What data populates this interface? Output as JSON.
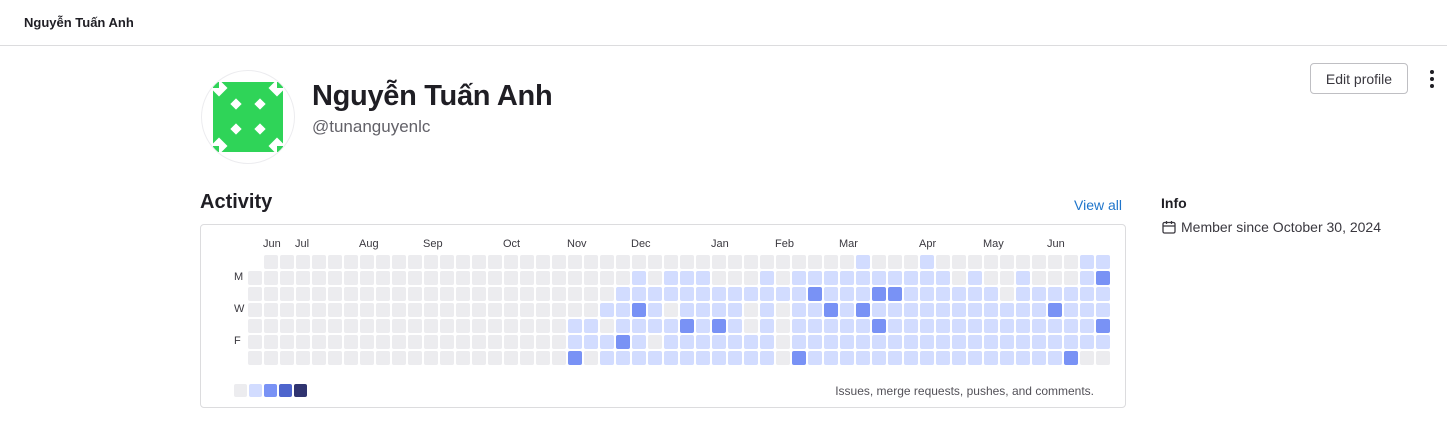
{
  "topbar": {
    "breadcrumb": "Nguyễn Tuấn Anh"
  },
  "profile": {
    "name": "Nguyễn Tuấn Anh",
    "handle": "@tunanguyenlc",
    "edit_label": "Edit profile",
    "more_icon": "more-vertical-icon",
    "avatar_colors": {
      "bg": "#2fd458",
      "dots": "#ffffff"
    }
  },
  "activity": {
    "title": "Activity",
    "view_all": "View all",
    "months": [
      {
        "label": "Jun",
        "week": 1
      },
      {
        "label": "Jul",
        "week": 3
      },
      {
        "label": "Aug",
        "week": 7
      },
      {
        "label": "Sep",
        "week": 11
      },
      {
        "label": "Oct",
        "week": 16
      },
      {
        "label": "Nov",
        "week": 20
      },
      {
        "label": "Dec",
        "week": 24
      },
      {
        "label": "Jan",
        "week": 29
      },
      {
        "label": "Feb",
        "week": 33
      },
      {
        "label": "Mar",
        "week": 37
      },
      {
        "label": "Apr",
        "week": 42
      },
      {
        "label": "May",
        "week": 46
      },
      {
        "label": "Jun",
        "week": 50
      }
    ],
    "day_labels": [
      {
        "label": "M",
        "row": 1
      },
      {
        "label": "W",
        "row": 3
      },
      {
        "label": "F",
        "row": 5
      }
    ],
    "levels_colors": [
      "#ececef",
      "#d2dcff",
      "#7992f5",
      "#4e65cd",
      "#303470"
    ],
    "weeks_level_map": [
      "0000000",
      "0000000",
      "0000000",
      "0000000",
      "0000000",
      "0000000",
      "0000000",
      "0000000",
      "0000000",
      "0000000",
      "0000000",
      "0000000",
      "0000000",
      "0000000",
      "0000000",
      "0000000",
      "0000000",
      "0000000",
      "0000000",
      "0000000",
      "0000112",
      "0000110",
      "0001011",
      "0011121",
      "0112111",
      "0011101",
      "0110111",
      "0111211",
      "0111111",
      "0011211",
      "0011111",
      "0010011",
      "0111111",
      "0010000",
      "0111112",
      "0121111",
      "0112111",
      "0111111",
      "1112111",
      "0121211",
      "0121111",
      "0111111",
      "1111111",
      "0111111",
      "0011111",
      "0111111",
      "0011111",
      "0001111",
      "0111111",
      "0011111",
      "0012111",
      "0011112",
      "1111110",
      "1211210"
    ],
    "legend_note": "Issues, merge requests, pushes, and comments."
  },
  "info": {
    "title": "Info",
    "member_since": "Member since October 30, 2024",
    "calendar_icon": "calendar-icon"
  }
}
